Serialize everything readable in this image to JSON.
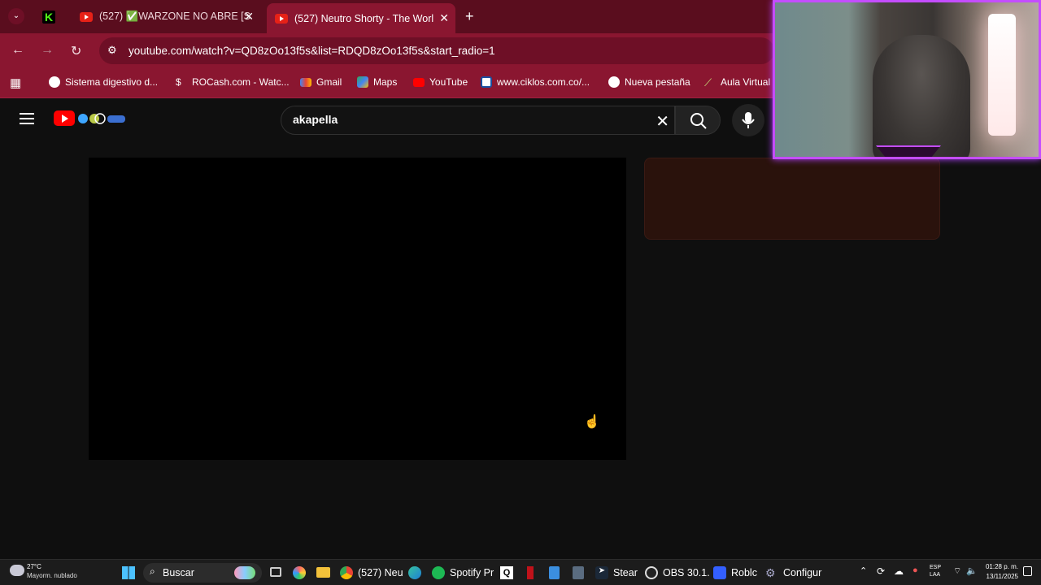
{
  "browser": {
    "tabs": [
      {
        "label": "(527) ✅WARZONE NO ABRE [S",
        "active": false
      },
      {
        "label": "(527) Neutro Shorty - The Worl",
        "active": true
      }
    ],
    "url": "youtube.com/watch?v=QD8zOo13f5s&list=RDQD8zOo13f5s&start_radio=1",
    "bookmarks": [
      "Sistema digestivo d...",
      "ROCash.com - Watc...",
      "Gmail",
      "Maps",
      "YouTube",
      "www.ciklos.com.co/...",
      "Nueva pestaña",
      "Aula Virtual"
    ]
  },
  "youtube": {
    "search_query": "akapella"
  },
  "taskbar": {
    "weather_temp": "27°C",
    "weather_desc": "Mayorm. nublado",
    "search_label": "Buscar",
    "apps": [
      "(527) Neu",
      "Spotify Pr",
      "Stear",
      "OBS 30.1.",
      "Roblc",
      "Configur"
    ],
    "lang_line1": "ESP",
    "lang_line2": "LAA",
    "time": "01:28 p. m.",
    "date": "13/11/2025"
  },
  "colors": {
    "browser_frame": "#8a1630",
    "tabstrip": "#5a0d1e",
    "webcam_border": "#c44dff",
    "youtube_red": "#ff0000"
  }
}
